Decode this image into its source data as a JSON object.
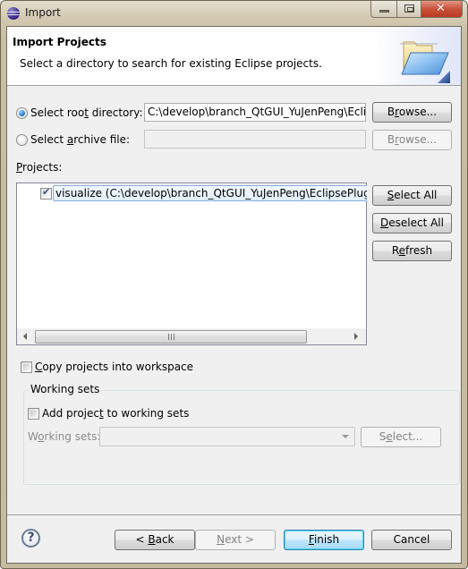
{
  "window": {
    "title": "Import",
    "controls": {
      "minimize": "minimize",
      "maximize": "maximize",
      "close": "✕"
    }
  },
  "header": {
    "title": "Import Projects",
    "subtitle": "Select a directory to search for existing Eclipse projects."
  },
  "source": {
    "root_directory": {
      "label_pre": "Select roo",
      "label_accel": "t",
      "label_post": " directory:",
      "selected": true,
      "value": "C:\\develop\\branch_QtGUI_YuJenPeng\\Eclip",
      "browse_pre": "B",
      "browse_accel": "r",
      "browse_post": "owse..."
    },
    "archive_file": {
      "label_pre": "Select ",
      "label_accel": "a",
      "label_post": "rchive file:",
      "selected": false,
      "value": "",
      "browse_pre": "B",
      "browse_accel": "r",
      "browse_post": "owse..."
    }
  },
  "projects": {
    "label_accel": "P",
    "label_post": "rojects:",
    "items": [
      {
        "label": "visualize (C:\\develop\\branch_QtGUI_YuJenPeng\\EclipsePlugin",
        "checked": true,
        "selected": true
      }
    ],
    "buttons": {
      "select_all_accel": "S",
      "select_all_post": "elect All",
      "deselect_all_accel": "D",
      "deselect_all_post": "eselect All",
      "refresh_pre": "R",
      "refresh_accel": "e",
      "refresh_post": "fresh"
    }
  },
  "options": {
    "copy_projects": {
      "label_accel": "C",
      "label_post": "opy projects into workspace",
      "checked": false
    }
  },
  "working_sets": {
    "legend": "Working sets",
    "add_to_sets": {
      "label_pre": "Add projec",
      "label_accel": "t",
      "label_post": " to working sets",
      "checked": false
    },
    "field_label_pre": "W",
    "field_label_accel": "o",
    "field_label_post": "rking sets:",
    "selected_value": "",
    "select_pre": "S",
    "select_accel": "e",
    "select_post": "lect..."
  },
  "footer": {
    "help": "?",
    "back_pre": "< ",
    "back_accel": "B",
    "back_post": "ack",
    "next_accel": "N",
    "next_post": "ext >",
    "finish_accel": "F",
    "finish_post": "inish",
    "cancel": "Cancel"
  },
  "colors": {
    "title_bar": "#d3c9b1",
    "close_button": "#c9513a",
    "dialog_bg": "#f0f0f0",
    "selection_border": "#84acdd",
    "default_button_border": "#3c7fb1"
  }
}
